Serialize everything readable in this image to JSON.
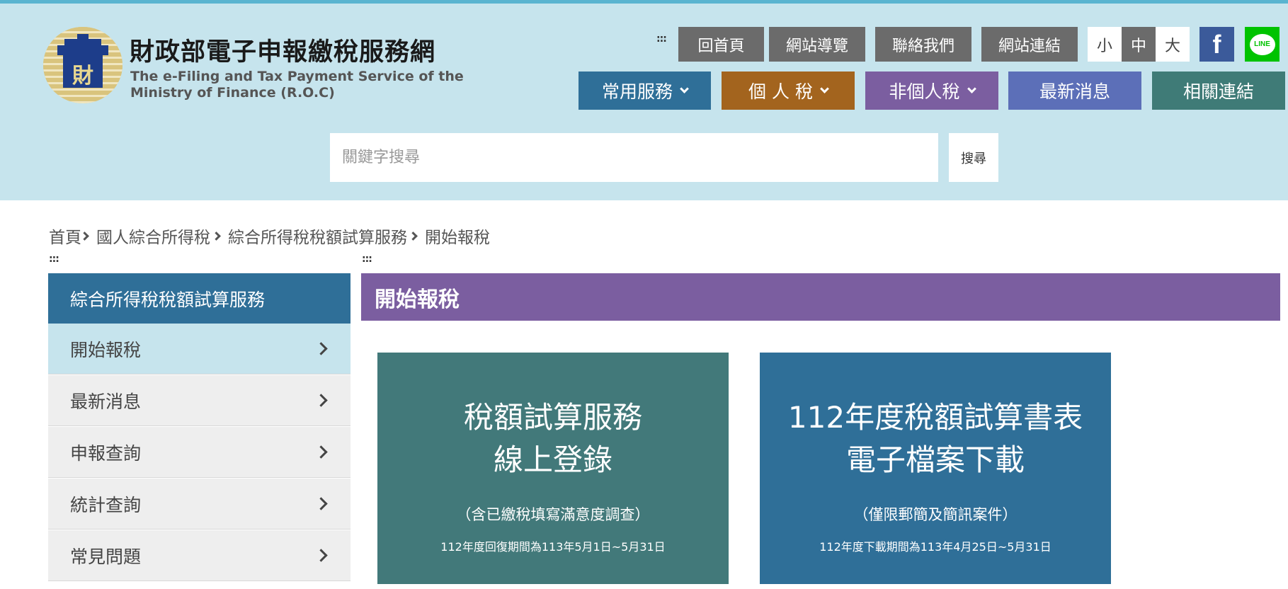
{
  "site": {
    "name_zh": "財政部電子申報繳稅服務網",
    "name_en_line1": "The e-Filing and Tax Payment Service of the",
    "name_en_line2": "Ministry of Finance (R.O.C)",
    "emblem_glyph": "財"
  },
  "top_nav": {
    "accesskey": ":::",
    "home": "回首頁",
    "sitemap": "網站導覽",
    "contact": "聯絡我們",
    "links": "網站連結",
    "font_small": "小",
    "font_medium": "中",
    "font_large": "大",
    "facebook_glyph": "f",
    "line_label": "LINE"
  },
  "main_nav": [
    {
      "label": "常用服務",
      "color": "#2f6f98"
    },
    {
      "label": "個 人 稅",
      "color": "#a3641e"
    },
    {
      "label": "非個人稅",
      "color": "#7b5ea0"
    },
    {
      "label": "最新消息",
      "color": "#5c6fb8"
    },
    {
      "label": "相關連結",
      "color": "#3f7b77"
    }
  ],
  "search": {
    "placeholder": "關鍵字搜尋",
    "button": "搜尋"
  },
  "breadcrumb": [
    "首頁",
    "國人綜合所得稅",
    "綜合所得稅稅額試算服務",
    "開始報稅"
  ],
  "accesskeys": {
    "left": ":::",
    "content": ":::"
  },
  "side_menu": {
    "title": "綜合所得稅稅額試算服務",
    "items": [
      "開始報稅",
      "最新消息",
      "申報查詢",
      "統計查詢",
      "常見問題"
    ],
    "active_index": 0
  },
  "content": {
    "title": "開始報稅",
    "cards": [
      {
        "line1": "稅額試算服務",
        "line2": "線上登錄",
        "note": "（含已繳稅填寫滿意度調查）",
        "period": "112年度回復期間為113年5月1日~5月31日"
      },
      {
        "line1": "112年度稅額試算書表",
        "line2": "電子檔案下載",
        "note": "（僅限郵簡及簡訊案件）",
        "period": "112年度下載期間為113年4月25日~5月31日"
      }
    ]
  },
  "colors": {
    "header_bg": "#c6e4ed",
    "side_title": "#2f6f98",
    "content_title": "#7b5ea0",
    "card_a": "#42797a",
    "card_b": "#2f6f98"
  }
}
